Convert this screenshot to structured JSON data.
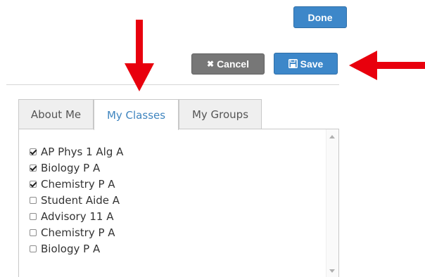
{
  "buttons": {
    "done_label": "Done",
    "cancel_label": "Cancel",
    "cancel_icon": "close-icon",
    "save_label": "Save",
    "save_icon": "floppy-disk-icon"
  },
  "colors": {
    "primary": "#3d87c9",
    "secondary": "#777777",
    "active_tab_text": "#3f85bf",
    "annotation_arrow": "#e8000d"
  },
  "tabs": [
    {
      "label": "About Me",
      "active": false
    },
    {
      "label": "My Classes",
      "active": true
    },
    {
      "label": "My Groups",
      "active": false
    }
  ],
  "classes": [
    {
      "label": "AP Phys 1 Alg A",
      "checked": true
    },
    {
      "label": "Biology P A",
      "checked": true
    },
    {
      "label": "Chemistry P A",
      "checked": true
    },
    {
      "label": "Student Aide A",
      "checked": false
    },
    {
      "label": "Advisory 11 A",
      "checked": false
    },
    {
      "label": "Chemistry P A",
      "checked": false
    },
    {
      "label": "Biology P A",
      "checked": false
    }
  ]
}
